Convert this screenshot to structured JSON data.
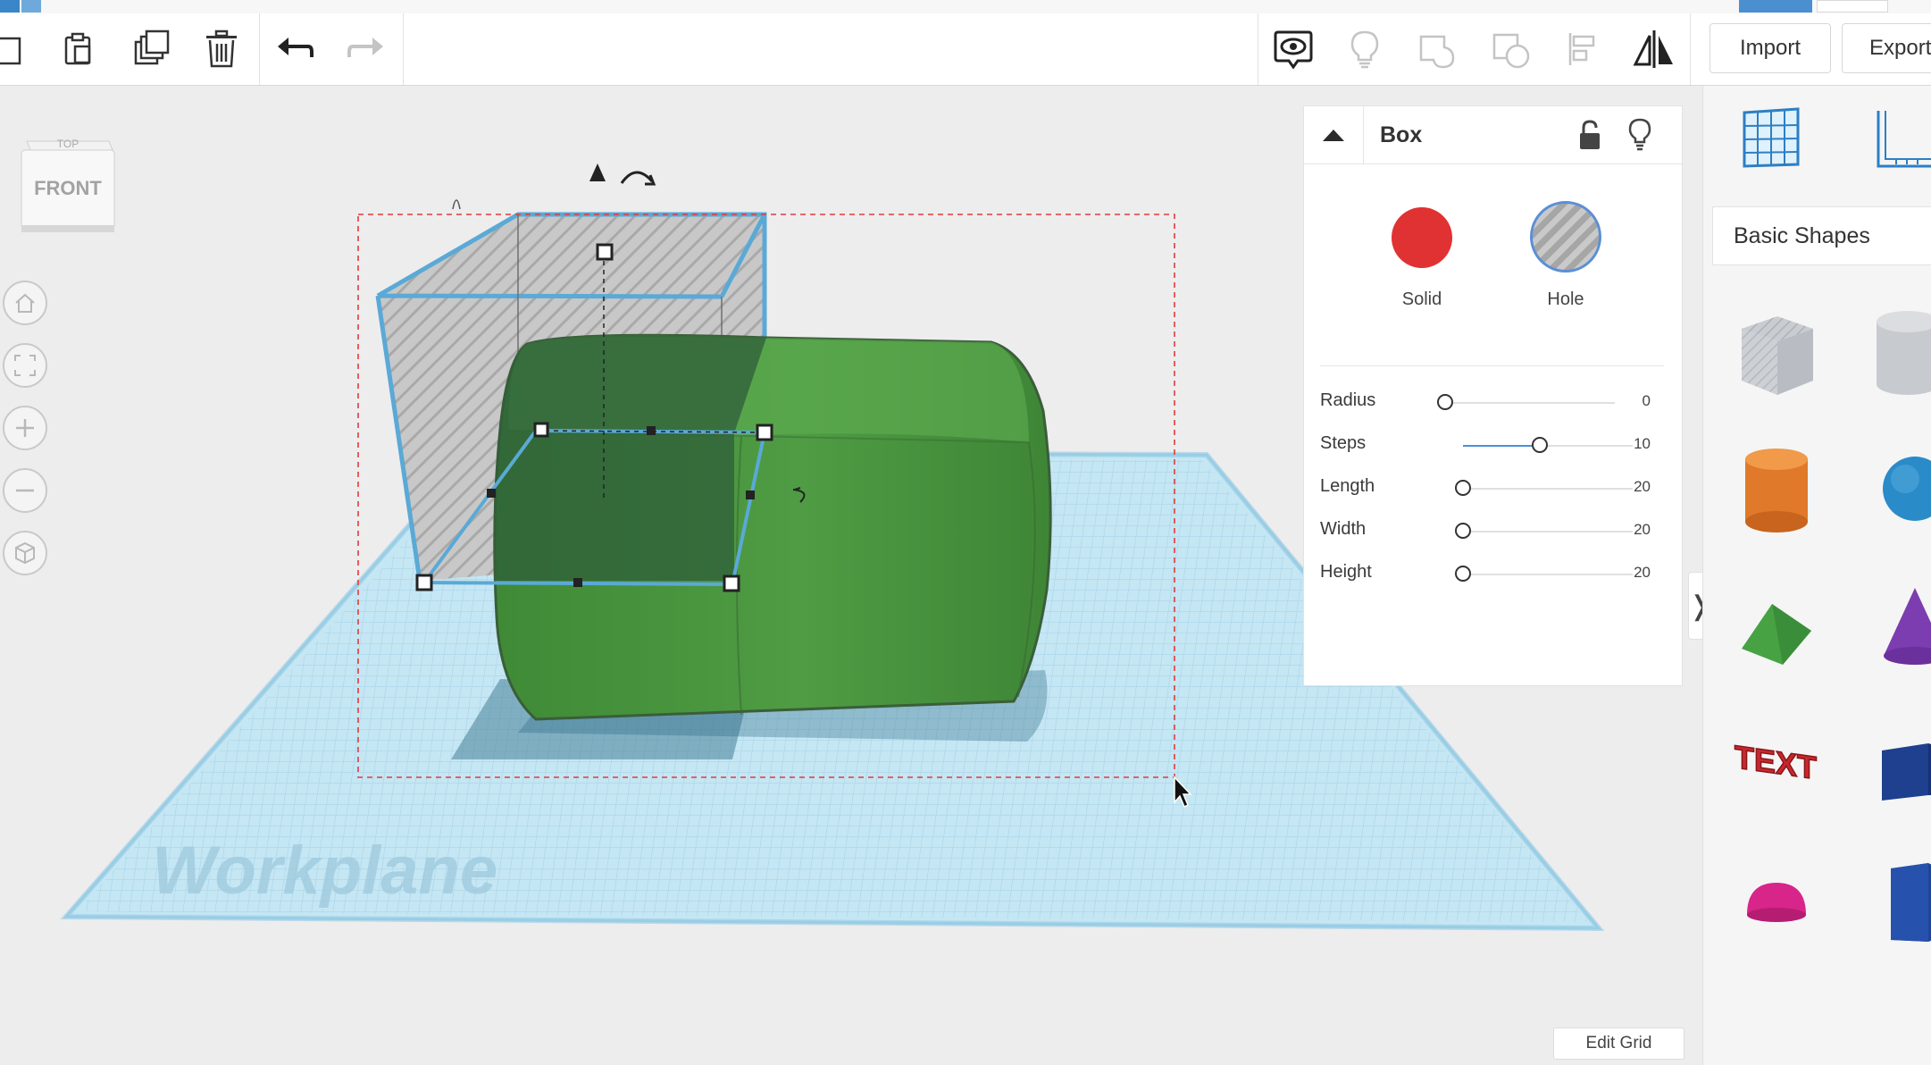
{
  "toolbar": {
    "import_label": "Import",
    "export_label": "Export",
    "left_tools": [
      "copy-icon",
      "paste-icon",
      "duplicate-icon",
      "delete-icon",
      "undo-icon",
      "redo-icon"
    ],
    "right_tools": [
      "show-all-icon",
      "notes-icon",
      "group-icon",
      "ungroup-icon",
      "align-icon",
      "mirror-icon"
    ]
  },
  "viewcube": {
    "top_label": "TOP",
    "front_label": "FRONT"
  },
  "nav": [
    "home-view-icon",
    "fit-view-icon",
    "zoom-in-icon",
    "zoom-out-icon",
    "perspective-icon"
  ],
  "workplane": {
    "label": "Workplane"
  },
  "inspector": {
    "title": "Box",
    "solid_label": "Solid",
    "hole_label": "Hole",
    "solid_color": "#e03232",
    "properties": [
      {
        "name": "Radius",
        "value": "0",
        "level": 0.0
      },
      {
        "name": "Steps",
        "value": "10",
        "level": 0.45
      },
      {
        "name": "Length",
        "value": "20",
        "level": 0.0
      },
      {
        "name": "Width",
        "value": "20",
        "level": 0.0
      },
      {
        "name": "Height",
        "value": "20",
        "level": 0.0
      }
    ]
  },
  "edit_grid_label": "Edit Grid",
  "library": {
    "category": "Basic Shapes",
    "shapes": [
      "box-hole",
      "cylinder-hole",
      "cylinder",
      "sphere",
      "roof",
      "cone",
      "text",
      "cube",
      "half-sphere",
      "hexagonal-prism"
    ]
  },
  "colors": {
    "accent": "#4a90d9",
    "workplane": "#bfe3f2",
    "green_shape": "#4f9a43",
    "hole_gray": "#b8b8b8"
  }
}
